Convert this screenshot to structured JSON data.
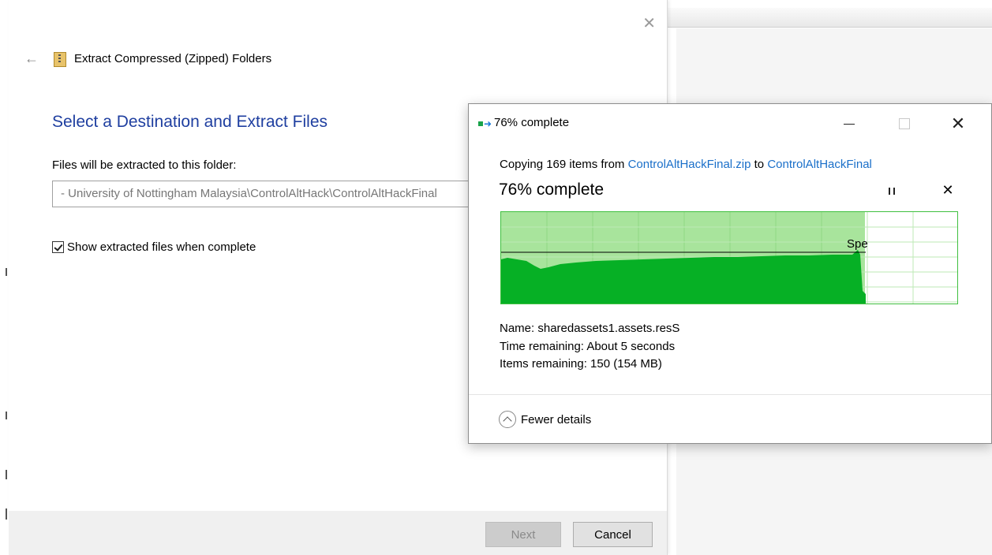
{
  "wizard": {
    "title": "Extract Compressed (Zipped) Folders",
    "heading": "Select a Destination and Extract Files",
    "folder_label": "Files will be extracted to this folder:",
    "folder_path": "- University of Nottingham Malaysia\\ControlAltHack\\ControlAltHackFinal",
    "show_files_label": "Show extracted files when complete",
    "show_files_checked": true,
    "next_label": "Next",
    "cancel_label": "Cancel",
    "icons": {
      "back": "back-arrow-icon",
      "close": "close-icon",
      "zip": "zip-folder-icon"
    }
  },
  "progress_dialog": {
    "title": "76% complete",
    "copying_prefix": "Copying 169 items from ",
    "source": "ControlAltHackFinal.zip",
    "copying_mid": " to ",
    "destination": "ControlAltHackFinal",
    "percent_text": "76% complete",
    "percent": 0.76,
    "speed_label": "Spe",
    "name_line": "Name: sharedassets1.assets.resS",
    "time_line": "Time remaining: About 5 seconds",
    "items_line": "Items remaining: 150 (154 MB)",
    "fewer_details": "Fewer details",
    "colors": {
      "progress_fill": "#a8e49c",
      "speed_fill": "#06b025",
      "grid": "#3fbf3f",
      "link": "#1a6fc9"
    },
    "icons": {
      "title": "copy-transfer-icon",
      "minimize": "minimize-icon",
      "maximize": "maximize-icon",
      "close": "close-icon",
      "pause": "pause-icon",
      "stop": "stop-icon",
      "collapse": "chevron-up-circle-icon"
    }
  }
}
